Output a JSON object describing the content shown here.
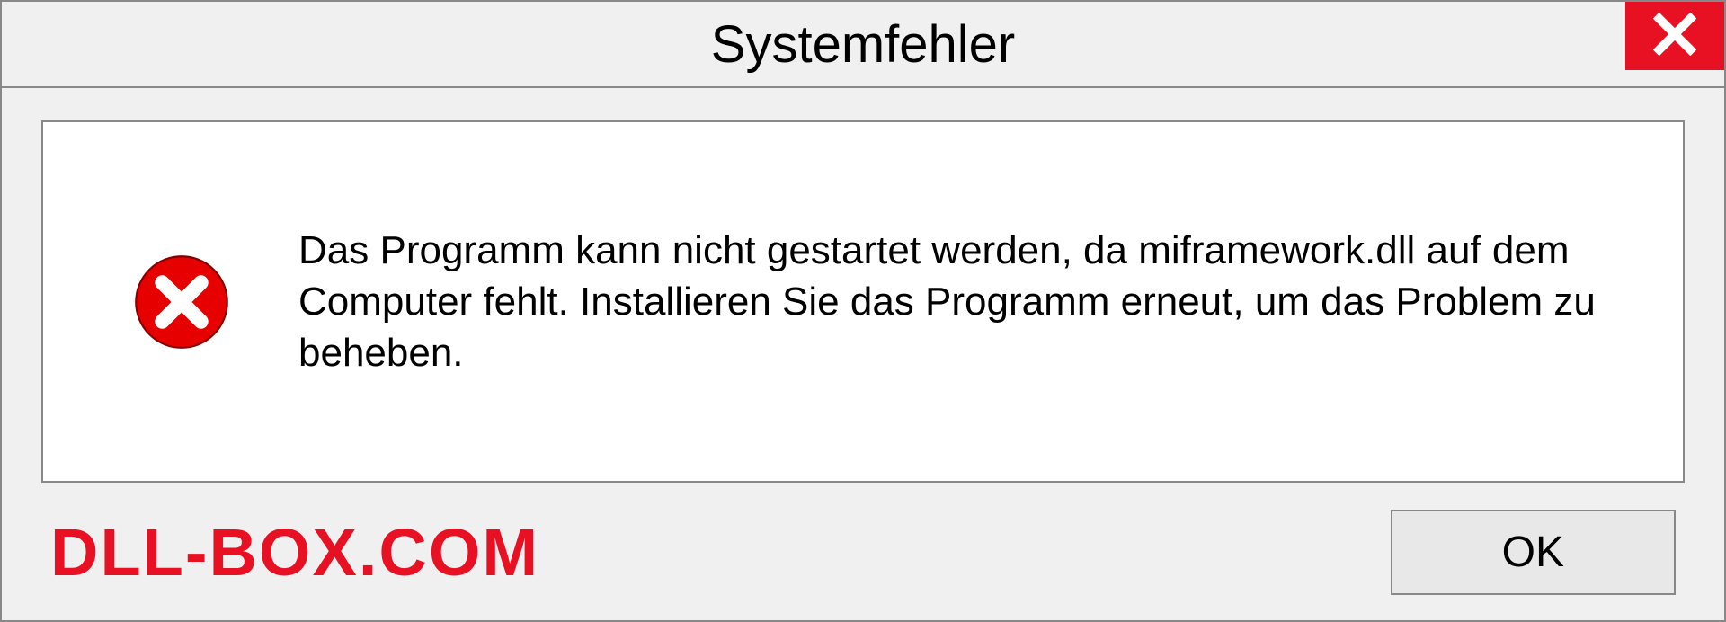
{
  "dialog": {
    "title": "Systemfehler",
    "message": "Das Programm kann nicht gestartet werden, da miframework.dll auf dem Computer fehlt. Installieren Sie das Programm erneut, um das Problem zu beheben.",
    "ok_label": "OK",
    "watermark": "DLL-BOX.COM"
  },
  "colors": {
    "error_red": "#e81123",
    "close_red": "#e81123"
  }
}
